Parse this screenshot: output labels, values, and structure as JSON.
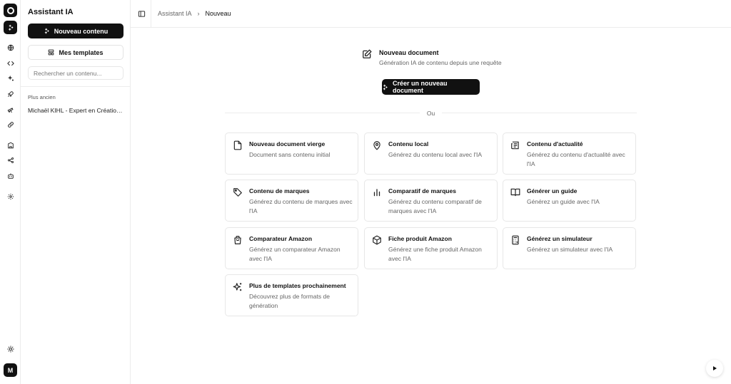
{
  "rail": {
    "avatar_letter": "M",
    "icons": [
      "logo-icon",
      "sparkles-icon",
      "globe-icon",
      "code-icon",
      "sparkles-small-icon",
      "rocket-icon",
      "telescope-icon",
      "link-icon",
      "building-icon",
      "share-icon",
      "bot-icon",
      "settings-icon",
      "sun-icon"
    ]
  },
  "sidebar": {
    "title": "Assistant IA",
    "new_content_label": "Nouveau contenu",
    "templates_label": "Mes templates",
    "search_placeholder": "Rechercher un contenu...",
    "section_label": "Plus ancien",
    "history": [
      "Michaël KIHL - Expert en Création de contenu"
    ]
  },
  "header": {
    "crumbs": [
      "Assistant IA",
      "Nouveau"
    ]
  },
  "hero": {
    "title": "Nouveau document",
    "subtitle": "Génération IA de contenu depuis une requête",
    "create_label": "Créer un nouveau document",
    "or_label": "Ou"
  },
  "cards": [
    {
      "title": "Nouveau document vierge",
      "desc": "Document sans contenu initial",
      "icon": "file-icon"
    },
    {
      "title": "Contenu local",
      "desc": "Générez du contenu local avec l'IA",
      "icon": "map-pin-icon"
    },
    {
      "title": "Contenu d'actualité",
      "desc": "Générez du contenu d'actualité avec l'IA",
      "icon": "newspaper-icon"
    },
    {
      "title": "Contenu de marques",
      "desc": "Générez du contenu de marques avec l'IA",
      "icon": "tag-icon"
    },
    {
      "title": "Comparatif de marques",
      "desc": "Générez du contenu comparatif de marques avec l'IA",
      "icon": "bar-chart-icon"
    },
    {
      "title": "Générer un guide",
      "desc": "Générez un guide avec l'IA",
      "icon": "book-open-icon"
    },
    {
      "title": "Comparateur Amazon",
      "desc": "Générez un comparateur Amazon avec l'IA",
      "icon": "shopping-bag-icon"
    },
    {
      "title": "Fiche produit Amazon",
      "desc": "Générez une fiche produit Amazon avec l'IA",
      "icon": "package-icon"
    },
    {
      "title": "Générez un simulateur",
      "desc": "Générez un simulateur avec l'IA",
      "icon": "calculator-icon"
    },
    {
      "title": "Plus de templates prochainement",
      "desc": "Découvrez plus de formats de génération",
      "icon": "sparkles-icon"
    }
  ]
}
